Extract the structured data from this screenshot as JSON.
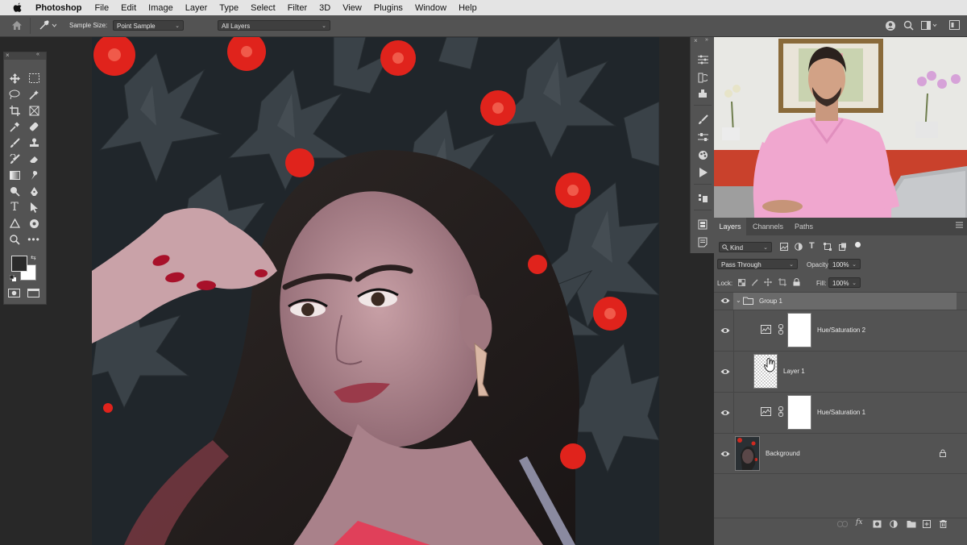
{
  "menubar": {
    "app_name": "Photoshop",
    "items": [
      "File",
      "Edit",
      "Image",
      "Layer",
      "Type",
      "Select",
      "Filter",
      "3D",
      "View",
      "Plugins",
      "Window",
      "Help"
    ]
  },
  "options_bar": {
    "sample_size_label": "Sample Size:",
    "sample_size_value": "Point Sample",
    "sample_layers_value": "All Layers"
  },
  "layers_panel": {
    "tabs": [
      "Layers",
      "Channels",
      "Paths"
    ],
    "active_tab": "Layers",
    "filter_kind": "Kind",
    "blend_mode": "Pass Through",
    "opacity_label": "Opacity:",
    "opacity_value": "100%",
    "lock_label": "Lock:",
    "fill_label": "Fill:",
    "fill_value": "100%",
    "layers": [
      {
        "name": "Group 1",
        "type": "group"
      },
      {
        "name": "Hue/Saturation 2",
        "type": "adjustment"
      },
      {
        "name": "Layer 1",
        "type": "pixel"
      },
      {
        "name": "Hue/Saturation 1",
        "type": "adjustment"
      },
      {
        "name": "Background",
        "type": "background"
      }
    ]
  },
  "colors": {
    "menubar_bg": "#e4e4e4",
    "panel_bg": "#535353",
    "workspace_bg": "#282828",
    "selected_row": "#6a6a6a",
    "flower_red": "#e0231c"
  },
  "icons": [
    "apple-icon",
    "home-icon",
    "eyedropper-icon",
    "search-icon",
    "eye-icon",
    "lock-icon",
    "folder-icon",
    "link-icon",
    "fx-icon",
    "trash-icon",
    "new-layer-icon",
    "mask-icon"
  ]
}
